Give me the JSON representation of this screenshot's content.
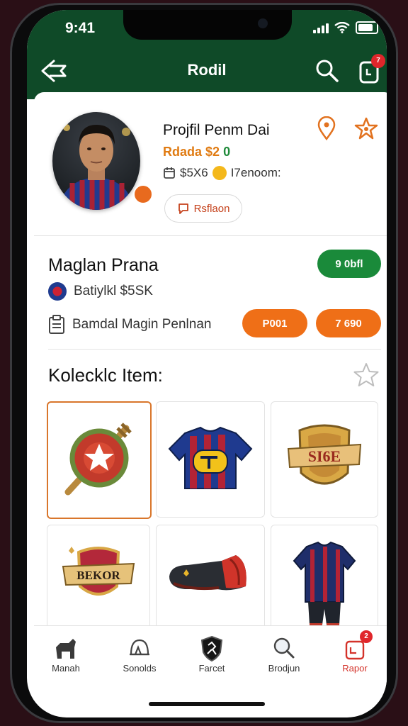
{
  "status_bar": {
    "time": "9:41"
  },
  "header": {
    "title": "Rodil",
    "notification_count": "7"
  },
  "profile": {
    "name": "Projfil Penm Dai",
    "subtitle": "Rdada $2",
    "subtitle_badge": "0",
    "stats_a": "$5X6",
    "stats_b": "I7enoom:",
    "action_label": "Rsflaon"
  },
  "info": {
    "player_name": "Maglan Prana",
    "green_button": "9 0bfl",
    "club": "Batiylkl $5SK",
    "document": "Bamdal Magin Penlnan",
    "orange_button_1": "P001",
    "orange_button_2": "7 690"
  },
  "collection": {
    "title": "Kolecklc Item:",
    "items": [
      {
        "name": "Shield emblem"
      },
      {
        "name": "Team jersey"
      },
      {
        "name": "Badge SI6E"
      },
      {
        "name": "Banner crest BEKOR"
      },
      {
        "name": "Football boot"
      },
      {
        "name": "Away jersey"
      }
    ],
    "badge_text": "SI6E",
    "banner_text": "BEKOR"
  },
  "bottom_nav": {
    "items": [
      {
        "label": "Manah"
      },
      {
        "label": "Sonolds"
      },
      {
        "label": "Farcet"
      },
      {
        "label": "Brodjun"
      },
      {
        "label": "Rapor"
      }
    ],
    "active_index": 4,
    "report_badge": "2"
  },
  "colors": {
    "header_green": "#0f4a28",
    "accent_orange": "#ef6f17",
    "accent_green": "#1a8a3a",
    "badge_red": "#e0262b"
  }
}
